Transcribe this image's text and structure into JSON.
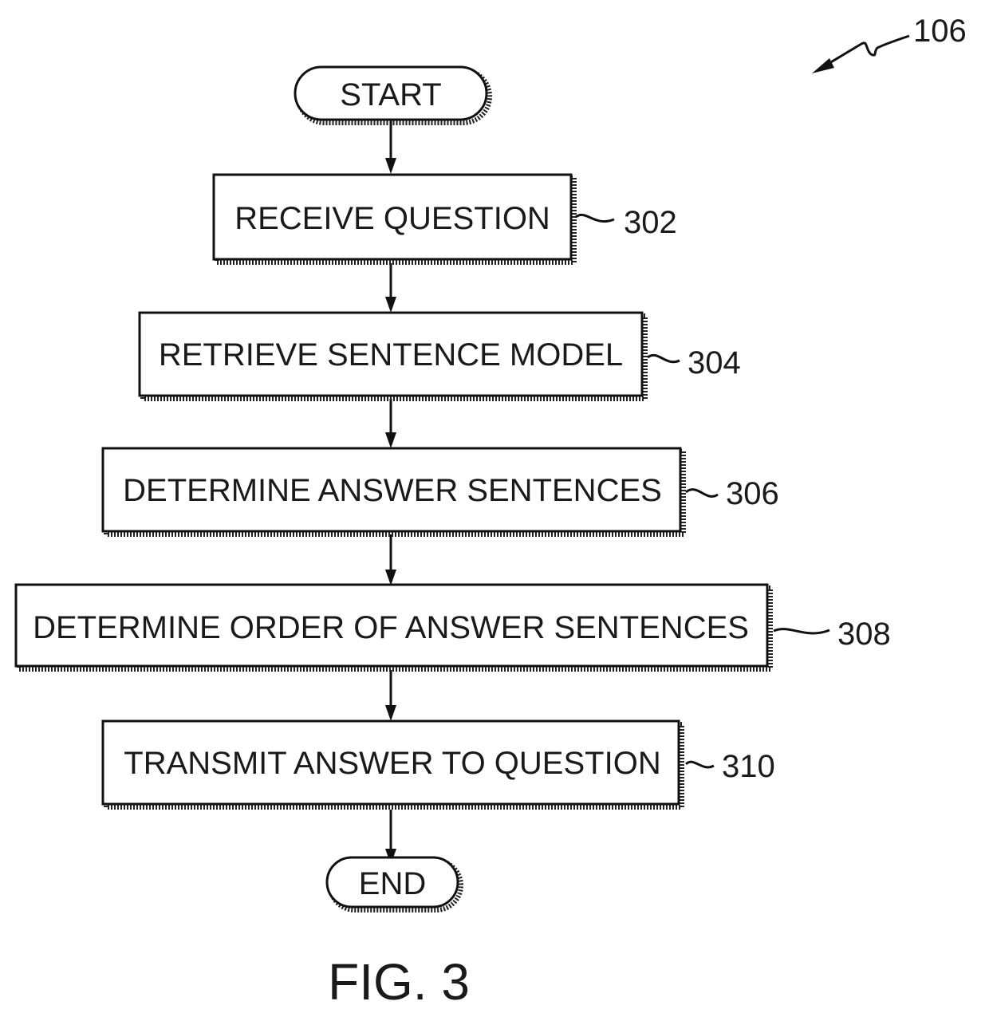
{
  "figure": {
    "reference": "106",
    "caption": "FIG. 3"
  },
  "flow": {
    "start": "START",
    "end": "END",
    "steps": [
      {
        "label": "RECEIVE QUESTION",
        "ref": "302"
      },
      {
        "label": "RETRIEVE SENTENCE MODEL",
        "ref": "304"
      },
      {
        "label": "DETERMINE ANSWER SENTENCES",
        "ref": "306"
      },
      {
        "label": "DETERMINE ORDER OF ANSWER SENTENCES",
        "ref": "308"
      },
      {
        "label": "TRANSMIT ANSWER TO QUESTION",
        "ref": "310"
      }
    ]
  }
}
